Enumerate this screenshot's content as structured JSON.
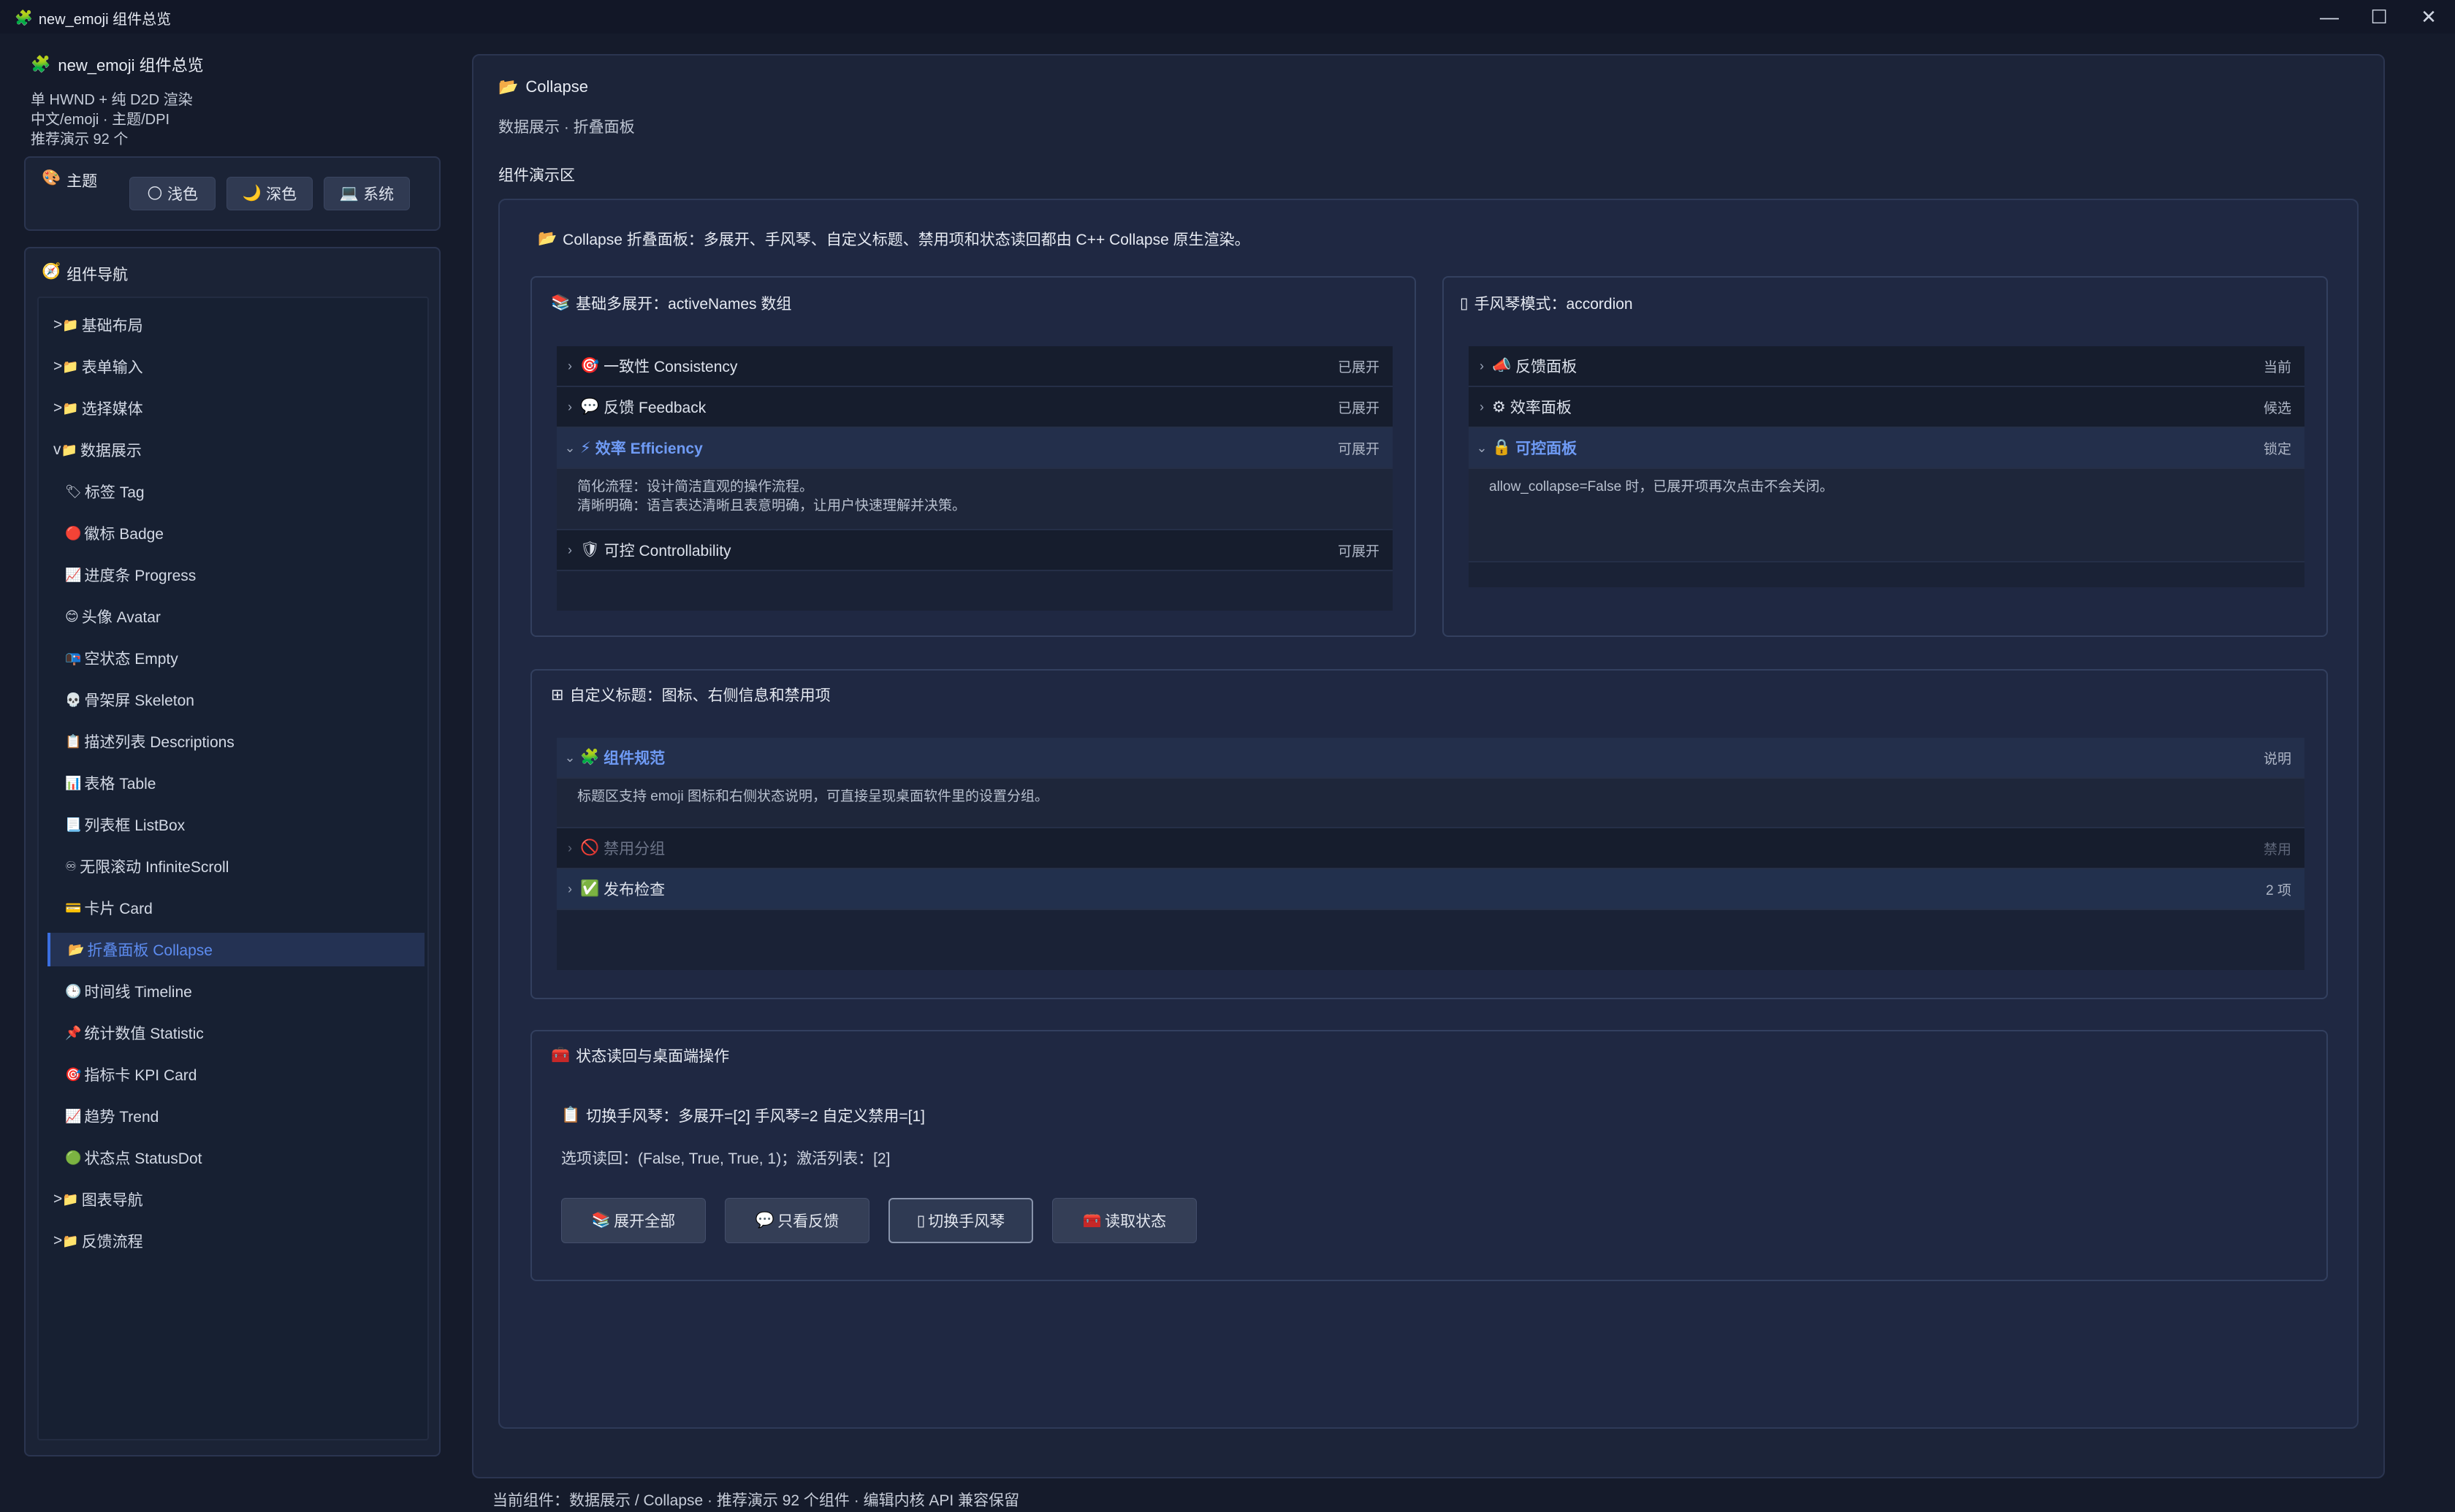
{
  "window": {
    "title": "new_emoji 组件总览",
    "title_icon": "🧩",
    "minimize": "—",
    "maximize": "☐",
    "close": "✕"
  },
  "sidebar": {
    "app_icon": "🧩",
    "app_title": "new_emoji 组件总览",
    "meta": [
      "单 HWND + 纯 D2D 渲染",
      "中文/emoji · 主题/DPI",
      "推荐演示 92 个"
    ],
    "theme": {
      "icon": "🎨",
      "label": "主题",
      "buttons": [
        {
          "icon": "🌕",
          "label": "浅色"
        },
        {
          "icon": "🌙",
          "label": "深色"
        },
        {
          "icon": "💻",
          "label": "系统"
        }
      ]
    },
    "nav": {
      "icon": "🧭",
      "label": "组件导航",
      "items": [
        {
          "type": "group",
          "prefix": ">",
          "icon": "📁",
          "label": "基础布局"
        },
        {
          "type": "group",
          "prefix": ">",
          "icon": "📁",
          "label": "表单输入"
        },
        {
          "type": "group",
          "prefix": ">",
          "icon": "📁",
          "label": "选择媒体"
        },
        {
          "type": "group",
          "prefix": "v",
          "icon": "📁",
          "label": "数据展示"
        },
        {
          "type": "child",
          "icon": "🏷",
          "label": "标签 Tag"
        },
        {
          "type": "child",
          "icon": "🔴",
          "label": "徽标 Badge"
        },
        {
          "type": "child",
          "icon": "📈",
          "label": "进度条 Progress"
        },
        {
          "type": "child",
          "icon": "😊",
          "label": "头像 Avatar"
        },
        {
          "type": "child",
          "icon": "📭",
          "label": "空状态 Empty"
        },
        {
          "type": "child",
          "icon": "💀",
          "label": "骨架屏 Skeleton"
        },
        {
          "type": "child",
          "icon": "📋",
          "label": "描述列表 Descriptions"
        },
        {
          "type": "child",
          "icon": "📊",
          "label": "表格 Table"
        },
        {
          "type": "child",
          "icon": "📃",
          "label": "列表框 ListBox"
        },
        {
          "type": "child",
          "icon": "♾",
          "label": "无限滚动 InfiniteScroll"
        },
        {
          "type": "child",
          "icon": "💳",
          "label": "卡片 Card"
        },
        {
          "type": "child",
          "icon": "📂",
          "label": "折叠面板 Collapse",
          "active": true
        },
        {
          "type": "child",
          "icon": "🕒",
          "label": "时间线 Timeline"
        },
        {
          "type": "child",
          "icon": "📌",
          "label": "统计数值 Statistic"
        },
        {
          "type": "child",
          "icon": "🎯",
          "label": "指标卡 KPI Card"
        },
        {
          "type": "child",
          "icon": "📈",
          "label": "趋势 Trend"
        },
        {
          "type": "child",
          "icon": "🟢",
          "label": "状态点 StatusDot"
        },
        {
          "type": "group",
          "prefix": ">",
          "icon": "📁",
          "label": "图表导航"
        },
        {
          "type": "group",
          "prefix": ">",
          "icon": "📁",
          "label": "反馈流程"
        }
      ]
    }
  },
  "main": {
    "title_icon": "📂",
    "title": "Collapse",
    "subtitle": "数据展示 · 折叠面板",
    "demo_label": "组件演示区",
    "intro_icon": "📂",
    "intro": "Collapse 折叠面板：多展开、手风琴、自定义标题、禁用项和状态读回都由 C++ Collapse 原生渲染。",
    "basic": {
      "icon": "📚",
      "title": "基础多展开：activeNames 数组",
      "rows": [
        {
          "chev": "›",
          "icon": "🎯",
          "label": "一致性 Consistency",
          "right": "已展开"
        },
        {
          "chev": "›",
          "icon": "💬",
          "label": "反馈 Feedback",
          "right": "已展开"
        },
        {
          "chev": "⌄",
          "icon": "⚡",
          "label": "效率 Efficiency",
          "right": "可展开",
          "open": true,
          "body": [
            "简化流程：设计简洁直观的操作流程。",
            "清晰明确：语言表达清晰且表意明确，让用户快速理解并决策。"
          ]
        },
        {
          "chev": "›",
          "icon": "🛡",
          "label": "可控 Controllability",
          "right": "可展开"
        }
      ]
    },
    "accordion": {
      "icon": "▯",
      "title": "手风琴模式：accordion",
      "rows": [
        {
          "chev": "›",
          "icon": "📣",
          "label": "反馈面板",
          "right": "当前"
        },
        {
          "chev": "›",
          "icon": "⚙",
          "label": "效率面板",
          "right": "候选"
        },
        {
          "chev": "⌄",
          "icon": "🔒",
          "label": "可控面板",
          "right": "锁定",
          "open": true,
          "body": [
            "allow_collapse=False 时，已展开项再次点击不会关闭。"
          ]
        }
      ]
    },
    "custom": {
      "icon": "⊞",
      "title": "自定义标题：图标、右侧信息和禁用项",
      "rows": [
        {
          "chev": "⌄",
          "icon": "🧩",
          "label": "组件规范",
          "right": "说明",
          "open": true,
          "body": [
            "标题区支持 emoji 图标和右侧状态说明，可直接呈现桌面软件里的设置分组。"
          ]
        },
        {
          "chev": "›",
          "icon": "🚫",
          "label": "禁用分组",
          "right": "禁用",
          "disabled": true
        },
        {
          "chev": "›",
          "icon": "✅",
          "label": "发布检查",
          "right": "2 项",
          "hl": true
        }
      ]
    },
    "state": {
      "icon": "🧰",
      "title": "状态读回与桌面端操作",
      "status_icon": "📋",
      "status": "切换手风琴：多展开=[2] 手风琴=2 自定义禁用=[1]",
      "readback": "选项读回：(False, True, True, 1)；激活列表：[2]",
      "buttons": [
        {
          "icon": "📚",
          "label": "展开全部"
        },
        {
          "icon": "💬",
          "label": "只看反馈"
        },
        {
          "icon": "▯",
          "label": "切换手风琴",
          "focus": true
        },
        {
          "icon": "🧰",
          "label": "读取状态"
        }
      ]
    }
  },
  "footer": "当前组件：数据展示 / Collapse · 推荐演示 92 个组件 · 编辑内核 API 兼容保留"
}
